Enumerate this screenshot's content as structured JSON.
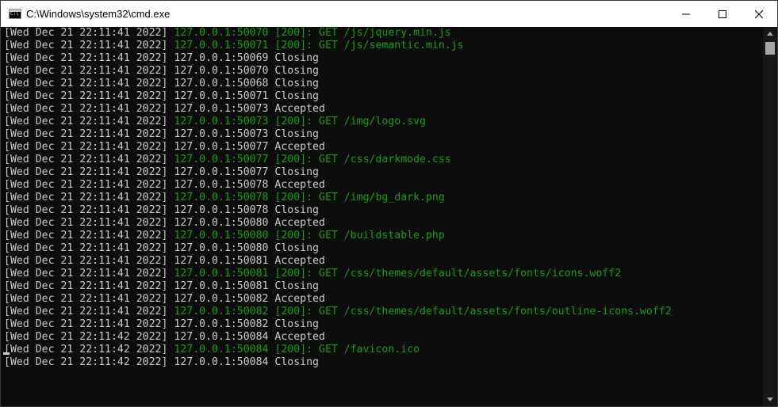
{
  "window": {
    "title": "C:\\Windows\\system32\\cmd.exe",
    "icon": "cmd-app-icon"
  },
  "controls": {
    "minimize_icon": "minimize-icon",
    "maximize_icon": "maximize-icon",
    "close_icon": "close-icon"
  },
  "colors": {
    "background": "#0c0c0c",
    "text": "#cccccc",
    "success": "#13a10e"
  },
  "console_lines": [
    {
      "ts": "[Wed Dec 21 22:11:41 2022]",
      "msg": "127.0.0.1:50070 [200]: GET /js/jquery.min.js",
      "status": "success"
    },
    {
      "ts": "[Wed Dec 21 22:11:41 2022]",
      "msg": "127.0.0.1:50071 [200]: GET /js/semantic.min.js",
      "status": "success"
    },
    {
      "ts": "[Wed Dec 21 22:11:41 2022]",
      "msg": "127.0.0.1:50069 Closing",
      "status": "info"
    },
    {
      "ts": "[Wed Dec 21 22:11:41 2022]",
      "msg": "127.0.0.1:50070 Closing",
      "status": "info"
    },
    {
      "ts": "[Wed Dec 21 22:11:41 2022]",
      "msg": "127.0.0.1:50068 Closing",
      "status": "info"
    },
    {
      "ts": "[Wed Dec 21 22:11:41 2022]",
      "msg": "127.0.0.1:50071 Closing",
      "status": "info"
    },
    {
      "ts": "[Wed Dec 21 22:11:41 2022]",
      "msg": "127.0.0.1:50073 Accepted",
      "status": "info"
    },
    {
      "ts": "[Wed Dec 21 22:11:41 2022]",
      "msg": "127.0.0.1:50073 [200]: GET /img/logo.svg",
      "status": "success"
    },
    {
      "ts": "[Wed Dec 21 22:11:41 2022]",
      "msg": "127.0.0.1:50073 Closing",
      "status": "info"
    },
    {
      "ts": "[Wed Dec 21 22:11:41 2022]",
      "msg": "127.0.0.1:50077 Accepted",
      "status": "info"
    },
    {
      "ts": "[Wed Dec 21 22:11:41 2022]",
      "msg": "127.0.0.1:50077 [200]: GET /css/darkmode.css",
      "status": "success"
    },
    {
      "ts": "[Wed Dec 21 22:11:41 2022]",
      "msg": "127.0.0.1:50077 Closing",
      "status": "info"
    },
    {
      "ts": "[Wed Dec 21 22:11:41 2022]",
      "msg": "127.0.0.1:50078 Accepted",
      "status": "info"
    },
    {
      "ts": "[Wed Dec 21 22:11:41 2022]",
      "msg": "127.0.0.1:50078 [200]: GET /img/bg_dark.png",
      "status": "success"
    },
    {
      "ts": "[Wed Dec 21 22:11:41 2022]",
      "msg": "127.0.0.1:50078 Closing",
      "status": "info"
    },
    {
      "ts": "[Wed Dec 21 22:11:41 2022]",
      "msg": "127.0.0.1:50080 Accepted",
      "status": "info"
    },
    {
      "ts": "[Wed Dec 21 22:11:41 2022]",
      "msg": "127.0.0.1:50080 [200]: GET /buildstable.php",
      "status": "success"
    },
    {
      "ts": "[Wed Dec 21 22:11:41 2022]",
      "msg": "127.0.0.1:50080 Closing",
      "status": "info"
    },
    {
      "ts": "[Wed Dec 21 22:11:41 2022]",
      "msg": "127.0.0.1:50081 Accepted",
      "status": "info"
    },
    {
      "ts": "[Wed Dec 21 22:11:41 2022]",
      "msg": "127.0.0.1:50081 [200]: GET /css/themes/default/assets/fonts/icons.woff2",
      "status": "success"
    },
    {
      "ts": "[Wed Dec 21 22:11:41 2022]",
      "msg": "127.0.0.1:50081 Closing",
      "status": "info"
    },
    {
      "ts": "[Wed Dec 21 22:11:41 2022]",
      "msg": "127.0.0.1:50082 Accepted",
      "status": "info"
    },
    {
      "ts": "[Wed Dec 21 22:11:41 2022]",
      "msg": "127.0.0.1:50082 [200]: GET /css/themes/default/assets/fonts/outline-icons.woff2",
      "status": "success"
    },
    {
      "ts": "[Wed Dec 21 22:11:41 2022]",
      "msg": "127.0.0.1:50082 Closing",
      "status": "info"
    },
    {
      "ts": "[Wed Dec 21 22:11:42 2022]",
      "msg": "127.0.0.1:50084 Accepted",
      "status": "info"
    },
    {
      "ts": "[Wed Dec 21 22:11:42 2022]",
      "msg": "127.0.0.1:50084 [200]: GET /favicon.ico",
      "status": "success"
    },
    {
      "ts": "[Wed Dec 21 22:11:42 2022]",
      "msg": "127.0.0.1:50084 Closing",
      "status": "info"
    }
  ],
  "scrollbar": {
    "up_icon": "scroll-up-arrow-icon",
    "down_icon": "scroll-down-arrow-icon"
  }
}
